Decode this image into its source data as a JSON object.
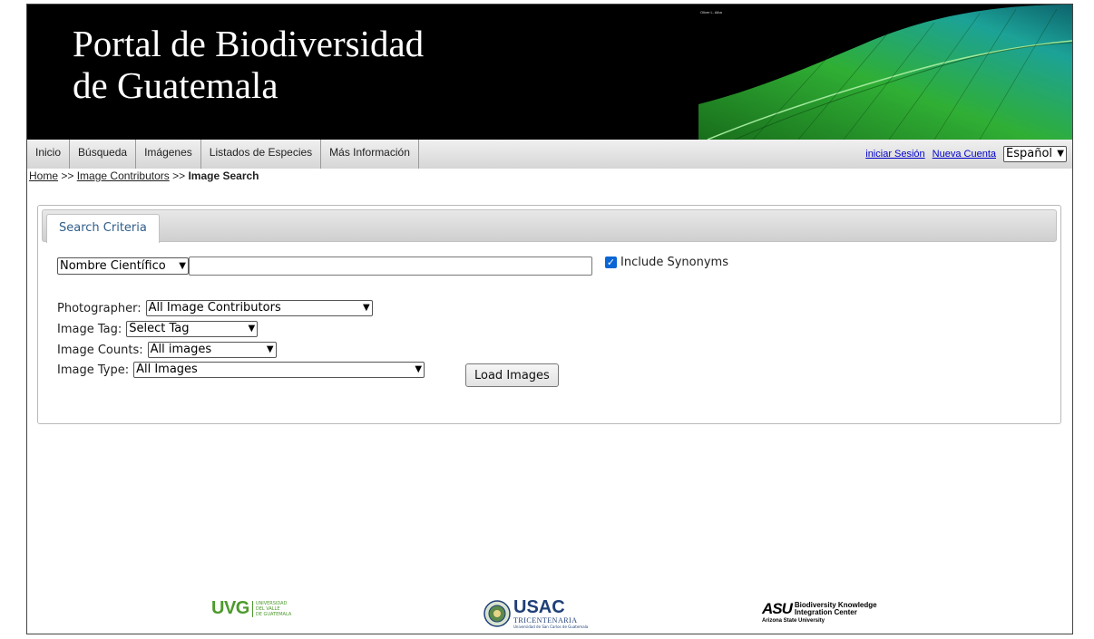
{
  "banner": {
    "title_line1": "Portal de Biodiversidad",
    "title_line2": "de Guatemala",
    "photo_credit": "Oliver L. Alba"
  },
  "menu": {
    "items": [
      {
        "label": "Inicio"
      },
      {
        "label": "Búsqueda"
      },
      {
        "label": "Imágenes"
      },
      {
        "label": "Listados de Especies"
      },
      {
        "label": "Más Información"
      }
    ],
    "login_label": "iniciar Sesión",
    "new_account_label": "Nueva Cuenta",
    "language_selected": "Español"
  },
  "breadcrumb": {
    "home": "Home",
    "separator": ">>",
    "contributors": "Image Contributors",
    "current": "Image Search"
  },
  "search": {
    "tab_label": "Search Criteria",
    "name_type_selected": "Nombre Científico",
    "taxon_value": "",
    "include_synonyms_label": "Include Synonyms",
    "include_synonyms_checked": true,
    "photographer_label": "Photographer:",
    "photographer_selected": "All Image Contributors",
    "image_tag_label": "Image Tag:",
    "image_tag_selected": "Select Tag",
    "image_counts_label": "Image Counts:",
    "image_counts_selected": "All images",
    "image_type_label": "Image Type:",
    "image_type_selected": "All Images",
    "load_button_label": "Load Images"
  },
  "footer": {
    "uvg_mark": "UVG",
    "uvg_text_line1": "UNIVERSIDAD",
    "uvg_text_line2": "DEL VALLE",
    "uvg_text_line3": "DE GUATEMALA",
    "usac_mark": "USAC",
    "usac_sub": "TRICENTENARIA",
    "usac_sub2": "Universidad de San Carlos de Guatemala",
    "asu_mark": "ASU",
    "asu_text_line1": "Biodiversity Knowledge",
    "asu_text_line2": "Integration Center",
    "asu_sub": "Arizona State University"
  },
  "colors": {
    "banner_bg": "#000000",
    "link": "#0000cc",
    "tab_text": "#2f5d8a",
    "checkbox": "#0a66d4",
    "feather_green": "#35c23a",
    "feather_teal": "#1fb4a8"
  }
}
